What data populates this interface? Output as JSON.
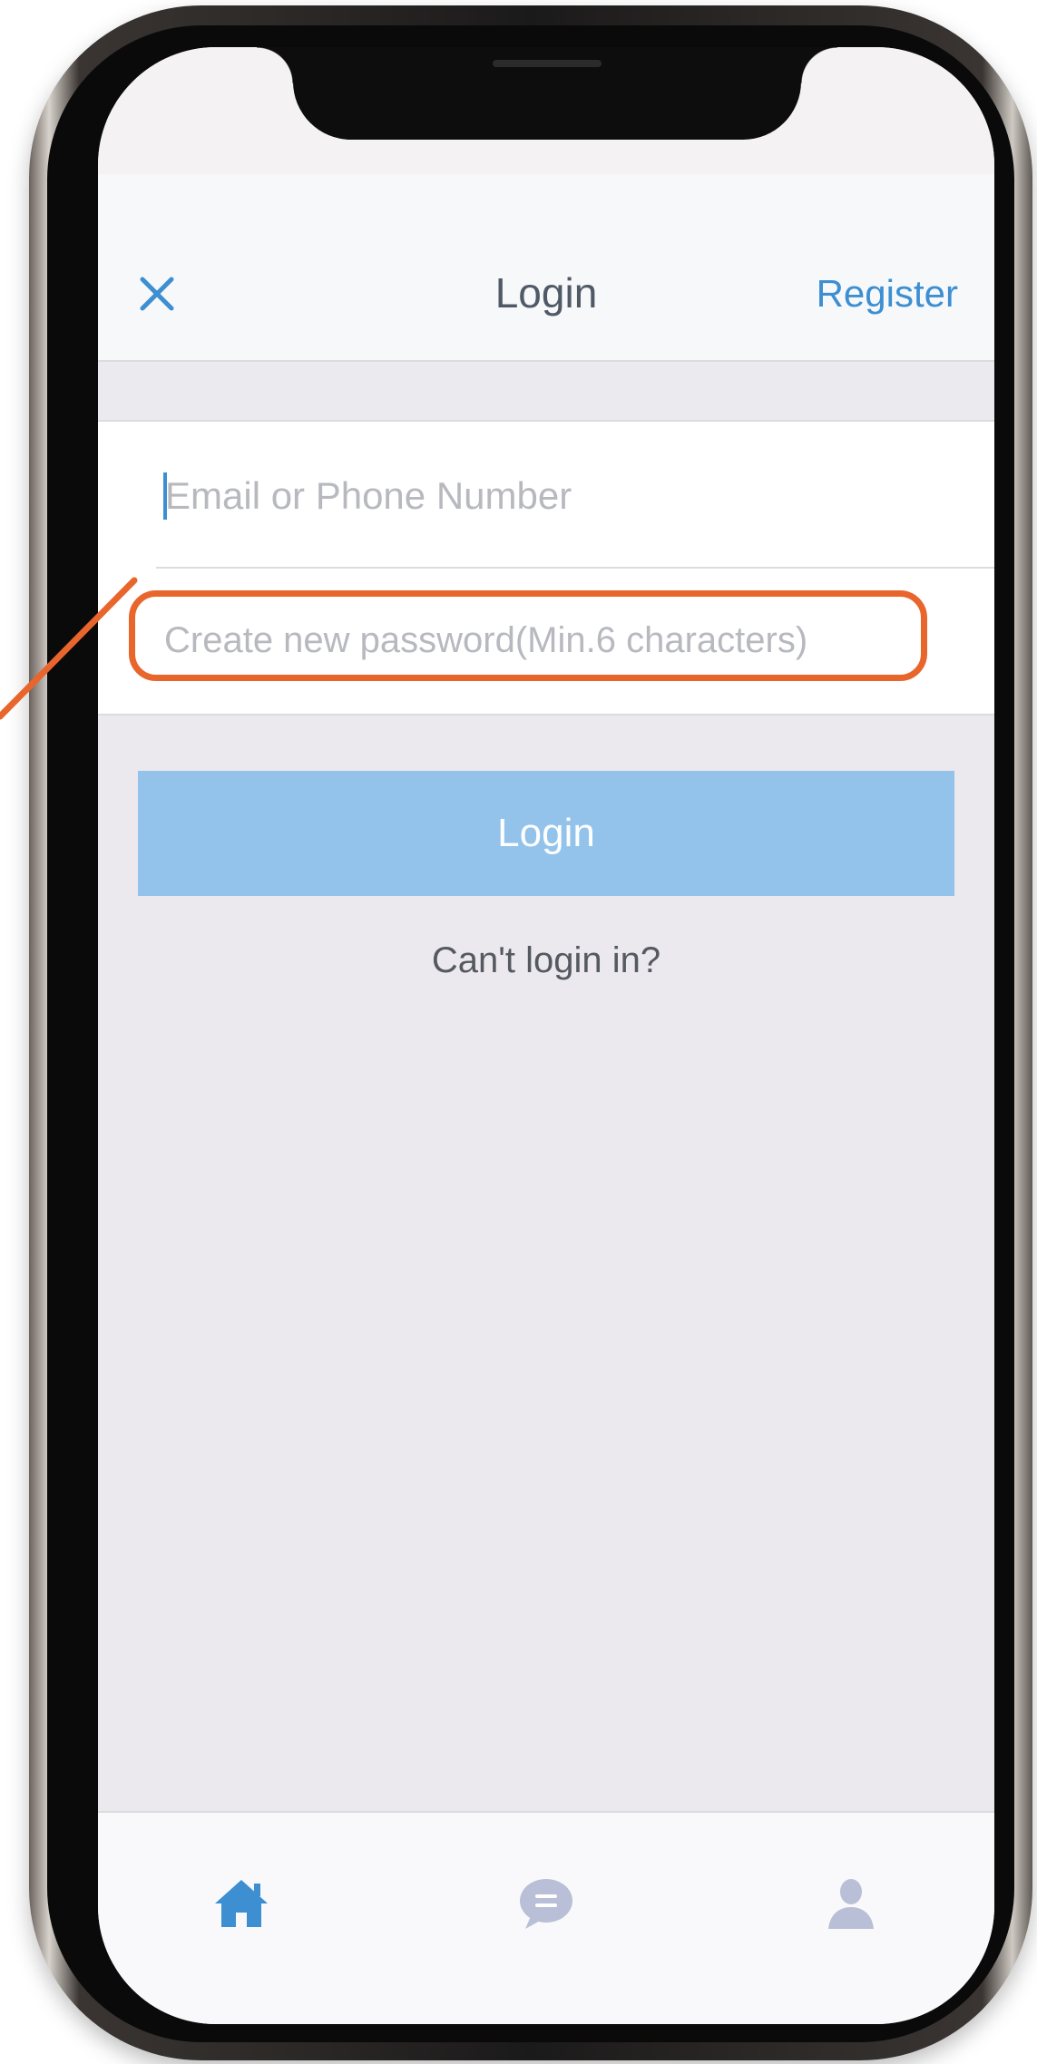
{
  "colors": {
    "accent": "#3d8fd1",
    "button": "#93c3ea",
    "highlight": "#e8652c",
    "icon_muted": "#b9bfd6"
  },
  "nav": {
    "close_icon": "close-icon",
    "title": "Login",
    "register_label": "Register"
  },
  "form": {
    "email_placeholder": "Email or Phone Number",
    "password_placeholder": "Create new password(Min.6 characters)"
  },
  "login_button_label": "Login",
  "cant_login_label": "Can't login in?",
  "tabs": [
    {
      "icon": "home-icon",
      "active": true
    },
    {
      "icon": "chat-icon",
      "active": false
    },
    {
      "icon": "user-icon",
      "active": false
    }
  ]
}
